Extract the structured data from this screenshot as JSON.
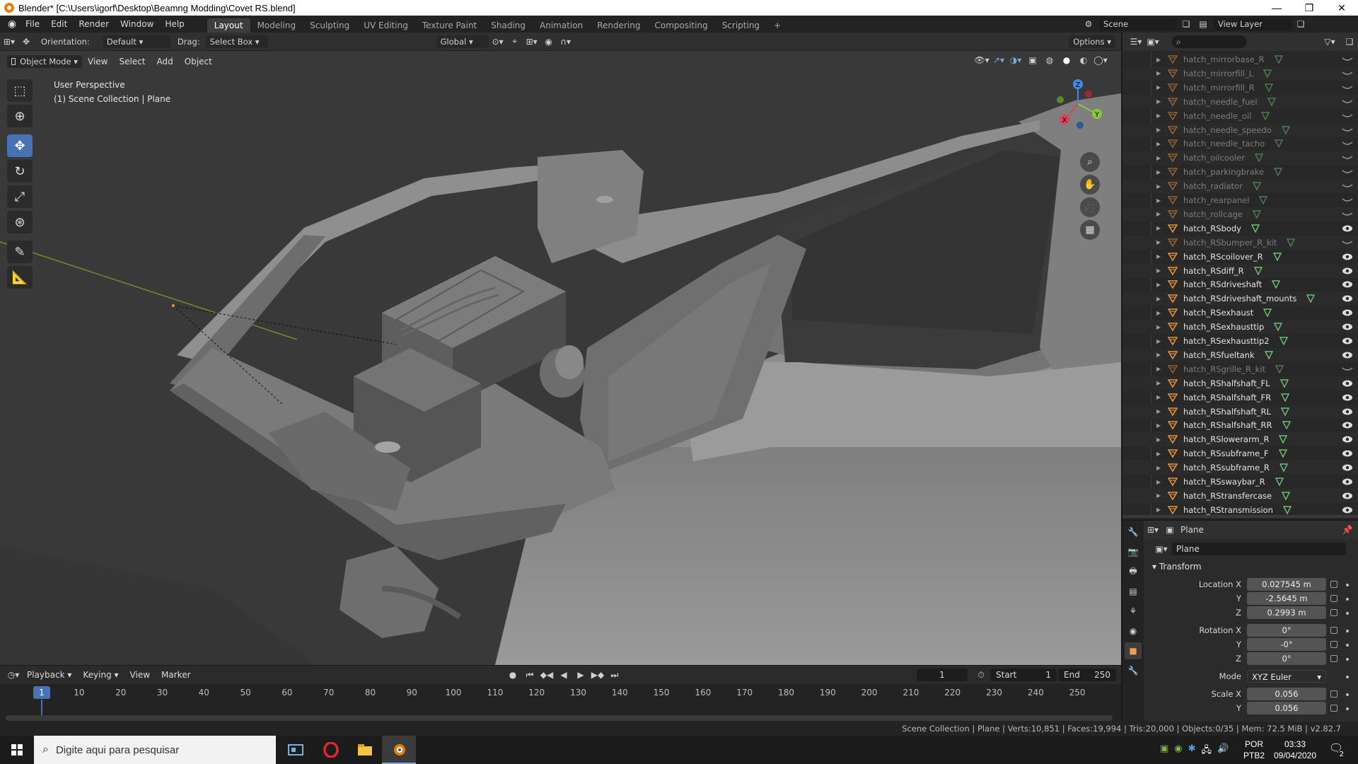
{
  "window": {
    "title": "Blender* [C:\\Users\\igorf\\Desktop\\Beamng Modding\\Covet RS.blend]",
    "minimize": "—",
    "maximize": "❐",
    "close": "✕"
  },
  "menu": [
    "File",
    "Edit",
    "Render",
    "Window",
    "Help"
  ],
  "workspaces": [
    {
      "label": "Layout",
      "active": true
    },
    {
      "label": "Modeling"
    },
    {
      "label": "Sculpting"
    },
    {
      "label": "UV Editing"
    },
    {
      "label": "Texture Paint"
    },
    {
      "label": "Shading"
    },
    {
      "label": "Animation"
    },
    {
      "label": "Rendering"
    },
    {
      "label": "Compositing"
    },
    {
      "label": "Scripting"
    }
  ],
  "scene": {
    "name": "Scene",
    "view_layer": "View Layer"
  },
  "vp_header": {
    "orientation_label": "Orientation:",
    "orientation_value": "Default",
    "drag_label": "Drag:",
    "drag_value": "Select Box",
    "transform_value": "Global",
    "options_label": "Options"
  },
  "vp_menu": {
    "mode": "Object Mode",
    "view": "View",
    "select": "Select",
    "add": "Add",
    "object": "Object"
  },
  "viewport_info": {
    "line1": "User Perspective",
    "line2": "(1) Scene Collection | Plane"
  },
  "gizmo": {
    "x": "X",
    "y": "Y",
    "z": "Z"
  },
  "outliner": {
    "items": [
      {
        "name": "hatch_mirrorbase_R",
        "visible": false
      },
      {
        "name": "hatch_mirrorfill_L",
        "visible": false
      },
      {
        "name": "hatch_mirrorfill_R",
        "visible": false
      },
      {
        "name": "hatch_needle_fuel",
        "visible": false
      },
      {
        "name": "hatch_needle_oil",
        "visible": false
      },
      {
        "name": "hatch_needle_speedo",
        "visible": false
      },
      {
        "name": "hatch_needle_tacho",
        "visible": false
      },
      {
        "name": "hatch_oilcooler",
        "visible": false
      },
      {
        "name": "hatch_parkingbrake",
        "visible": false
      },
      {
        "name": "hatch_radiator",
        "visible": false
      },
      {
        "name": "hatch_rearpanel",
        "visible": false
      },
      {
        "name": "hatch_rollcage",
        "visible": false
      },
      {
        "name": "hatch_RSbody",
        "visible": true
      },
      {
        "name": "hatch_RSbumper_R_kit",
        "visible": false
      },
      {
        "name": "hatch_RScoilover_R",
        "visible": true
      },
      {
        "name": "hatch_RSdiff_R",
        "visible": true
      },
      {
        "name": "hatch_RSdriveshaft",
        "visible": true
      },
      {
        "name": "hatch_RSdriveshaft_mounts",
        "visible": true
      },
      {
        "name": "hatch_RSexhaust",
        "visible": true
      },
      {
        "name": "hatch_RSexhausttip",
        "visible": true
      },
      {
        "name": "hatch_RSexhausttip2",
        "visible": true
      },
      {
        "name": "hatch_RSfueltank",
        "visible": true
      },
      {
        "name": "hatch_RSgrille_R_kit",
        "visible": false
      },
      {
        "name": "hatch_RShalfshaft_FL",
        "visible": true
      },
      {
        "name": "hatch_RShalfshaft_FR",
        "visible": true
      },
      {
        "name": "hatch_RShalfshaft_RL",
        "visible": true
      },
      {
        "name": "hatch_RShalfshaft_RR",
        "visible": true
      },
      {
        "name": "hatch_RSlowerarm_R",
        "visible": true
      },
      {
        "name": "hatch_RSsubframe_F",
        "visible": true
      },
      {
        "name": "hatch_RSsubframe_R",
        "visible": true
      },
      {
        "name": "hatch_RSswaybar_R",
        "visible": true
      },
      {
        "name": "hatch_RStransfercase",
        "visible": true
      },
      {
        "name": "hatch_RStransmission",
        "visible": true
      }
    ]
  },
  "properties": {
    "object_header": "Plane",
    "object_name": "Plane",
    "panel_title": "Transform",
    "location_label": "Location X",
    "location": {
      "x": "0.027545 m",
      "y": "-2.5645 m",
      "z": "0.2993 m"
    },
    "rotation_label": "Rotation X",
    "rotation": {
      "x": "0°",
      "y": "-0°",
      "z": "0°"
    },
    "mode_label": "Mode",
    "mode_value": "XYZ Euler",
    "scale_label": "Scale X",
    "scale": {
      "x": "0.056",
      "y": "0.056"
    },
    "y_label": "Y",
    "z_label": "Z"
  },
  "timeline": {
    "menus": [
      "Playback",
      "Keying",
      "View",
      "Marker"
    ],
    "current_frame": "1",
    "start_label": "Start",
    "start": "1",
    "end_label": "End",
    "end": "250",
    "ticks": [
      "10",
      "20",
      "30",
      "40",
      "50",
      "60",
      "70",
      "80",
      "90",
      "100",
      "110",
      "120",
      "130",
      "140",
      "150",
      "160",
      "170",
      "180",
      "190",
      "200",
      "210",
      "220",
      "230",
      "240",
      "250"
    ]
  },
  "statusbar": {
    "stats": "Scene Collection | Plane | Verts:10,851 | Faces:19,994 | Tris:20,000 | Objects:0/35 | Mem: 72.5 MiB | v2.82.7"
  },
  "taskbar": {
    "search_placeholder": "Digite aqui para pesquisar",
    "lang1": "POR",
    "lang2": "PTB2",
    "time": "03:33",
    "date": "09/04/2020",
    "notif_count": "2"
  },
  "colors": {
    "accent": "#4772b3",
    "viewport_bg": "#393939",
    "object_orange": "#e8913a",
    "mesh_green": "#6fbf73",
    "x_axis": "#e0405a",
    "y_axis": "#8cc63f",
    "z_axis": "#3c8ce6"
  }
}
